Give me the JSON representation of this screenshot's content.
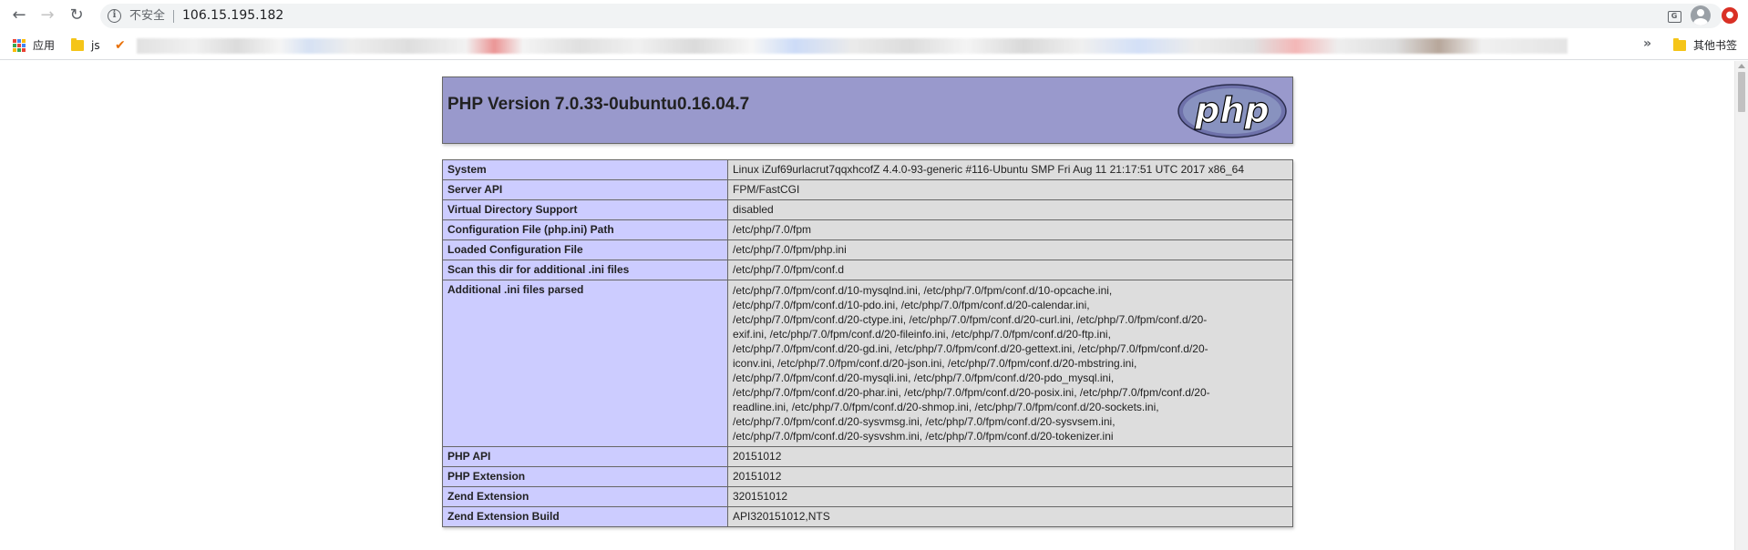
{
  "browser": {
    "security_label": "不安全",
    "url": "106.15.195.182",
    "bookmarks": {
      "apps_label": "应用",
      "js_folder_label": "js",
      "overflow_label": "»",
      "other_bookmarks_label": "其他书签"
    },
    "icons": {
      "back": "back-arrow-icon",
      "forward": "forward-arrow-icon",
      "reload": "reload-icon",
      "info": "info-icon",
      "translate": "translate-icon",
      "bookmark_star": "star-icon",
      "profile": "profile-icon",
      "extension": "extension-icon"
    }
  },
  "phpinfo": {
    "title": "PHP Version 7.0.33-0ubuntu0.16.04.7",
    "logo_text": "php",
    "colors": {
      "header_bg": "#9999cc",
      "key_bg": "#ccccff",
      "value_bg": "#dddddd"
    },
    "rows": [
      {
        "key": "System",
        "value": "Linux iZuf69urlacrut7qqxhcofZ 4.4.0-93-generic #116-Ubuntu SMP Fri Aug 11 21:17:51 UTC 2017 x86_64"
      },
      {
        "key": "Server API",
        "value": "FPM/FastCGI"
      },
      {
        "key": "Virtual Directory Support",
        "value": "disabled"
      },
      {
        "key": "Configuration File (php.ini) Path",
        "value": "/etc/php/7.0/fpm"
      },
      {
        "key": "Loaded Configuration File",
        "value": "/etc/php/7.0/fpm/php.ini"
      },
      {
        "key": "Scan this dir for additional .ini files",
        "value": "/etc/php/7.0/fpm/conf.d"
      },
      {
        "key": "Additional .ini files parsed",
        "lines": [
          "/etc/php/7.0/fpm/conf.d/10-mysqlnd.ini, /etc/php/7.0/fpm/conf.d/10-opcache.ini,",
          "/etc/php/7.0/fpm/conf.d/10-pdo.ini, /etc/php/7.0/fpm/conf.d/20-calendar.ini,",
          "/etc/php/7.0/fpm/conf.d/20-ctype.ini, /etc/php/7.0/fpm/conf.d/20-curl.ini, /etc/php/7.0/fpm/conf.d/20-",
          "exif.ini, /etc/php/7.0/fpm/conf.d/20-fileinfo.ini, /etc/php/7.0/fpm/conf.d/20-ftp.ini,",
          "/etc/php/7.0/fpm/conf.d/20-gd.ini, /etc/php/7.0/fpm/conf.d/20-gettext.ini, /etc/php/7.0/fpm/conf.d/20-",
          "iconv.ini, /etc/php/7.0/fpm/conf.d/20-json.ini, /etc/php/7.0/fpm/conf.d/20-mbstring.ini,",
          "/etc/php/7.0/fpm/conf.d/20-mysqli.ini, /etc/php/7.0/fpm/conf.d/20-pdo_mysql.ini,",
          "/etc/php/7.0/fpm/conf.d/20-phar.ini, /etc/php/7.0/fpm/conf.d/20-posix.ini, /etc/php/7.0/fpm/conf.d/20-",
          "readline.ini, /etc/php/7.0/fpm/conf.d/20-shmop.ini, /etc/php/7.0/fpm/conf.d/20-sockets.ini,",
          "/etc/php/7.0/fpm/conf.d/20-sysvmsg.ini, /etc/php/7.0/fpm/conf.d/20-sysvsem.ini,",
          "/etc/php/7.0/fpm/conf.d/20-sysvshm.ini, /etc/php/7.0/fpm/conf.d/20-tokenizer.ini"
        ]
      },
      {
        "key": "PHP API",
        "value": "20151012"
      },
      {
        "key": "PHP Extension",
        "value": "20151012"
      },
      {
        "key": "Zend Extension",
        "value": "320151012"
      },
      {
        "key": "Zend Extension Build",
        "value": "API320151012,NTS"
      }
    ]
  }
}
